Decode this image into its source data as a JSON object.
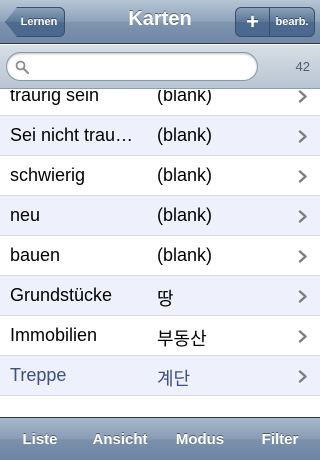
{
  "navbar": {
    "back_label": "Lernen",
    "title": "Karten",
    "add_label": "+",
    "edit_label": "bearb."
  },
  "search": {
    "value": "",
    "placeholder": "",
    "count": "42"
  },
  "cards": [
    {
      "term": "traurig sein",
      "meaning": "(blank)"
    },
    {
      "term": "Sei nicht trau…",
      "meaning": "(blank)"
    },
    {
      "term": "schwierig",
      "meaning": "(blank)"
    },
    {
      "term": "neu",
      "meaning": "(blank)"
    },
    {
      "term": "bauen",
      "meaning": "(blank)"
    },
    {
      "term": "Grundstücke",
      "meaning": "땅"
    },
    {
      "term": "Immobilien",
      "meaning": "부동산"
    },
    {
      "term": "Treppe",
      "meaning": "계단"
    }
  ],
  "tabs": [
    {
      "label": "Liste"
    },
    {
      "label": "Ansicht"
    },
    {
      "label": "Modus"
    },
    {
      "label": "Filter"
    }
  ],
  "colors": {
    "highlight_text": "#3a5086",
    "alt_row": "#eef0fb"
  }
}
